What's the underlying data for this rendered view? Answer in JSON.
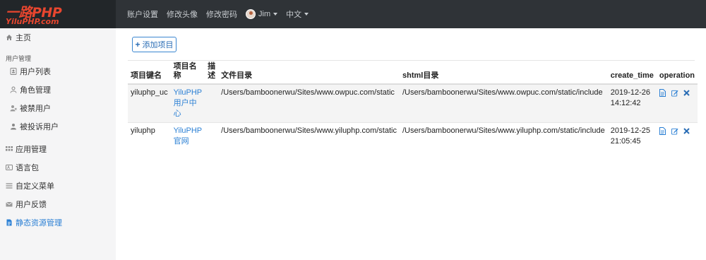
{
  "brand": {
    "main": "一路PHP",
    "sub": "YiluPHP.com",
    "color": "#e8462f"
  },
  "topnav": {
    "account_settings": "账户设置",
    "change_avatar": "修改头像",
    "change_password": "修改密码",
    "user": "Jim",
    "language": "中文"
  },
  "sidebar": {
    "home": "主页",
    "user_mgmt_header": "用户管理",
    "user_list": "用户列表",
    "role_mgmt": "角色管理",
    "banned_users": "被禁用户",
    "complained_users": "被投诉用户",
    "app_mgmt": "应用管理",
    "language_pack": "语言包",
    "custom_menu": "自定义菜单",
    "user_feedback": "用户反馈",
    "static_resources": "静态资源管理"
  },
  "main": {
    "add_button": "添加项目",
    "table": {
      "headers": {
        "key": "项目键名",
        "name": "项目名称",
        "desc": "描述",
        "dir": "文件目录",
        "shtml": "shtml目录",
        "create_time": "create_time",
        "operation": "operation"
      },
      "rows": [
        {
          "key": "yiluphp_uc",
          "name": "YiluPHP用户中心",
          "desc": "",
          "dir": "/Users/bamboonerwu/Sites/www.owpuc.com/static",
          "shtml": "/Users/bamboonerwu/Sites/www.owpuc.com/static/include",
          "create_date": "2019-12-26",
          "create_clock": "14:12:42"
        },
        {
          "key": "yiluphp",
          "name": "YiluPHP官网",
          "desc": "",
          "dir": "/Users/bamboonerwu/Sites/www.yiluphp.com/static",
          "shtml": "/Users/bamboonerwu/Sites/www.yiluphp.com/static/include",
          "create_date": "2019-12-25",
          "create_clock": "21:05:45"
        }
      ]
    }
  },
  "colors": {
    "accent": "#2a7fd4",
    "topbar": "#2f3337",
    "delete": "#2a6db5"
  }
}
